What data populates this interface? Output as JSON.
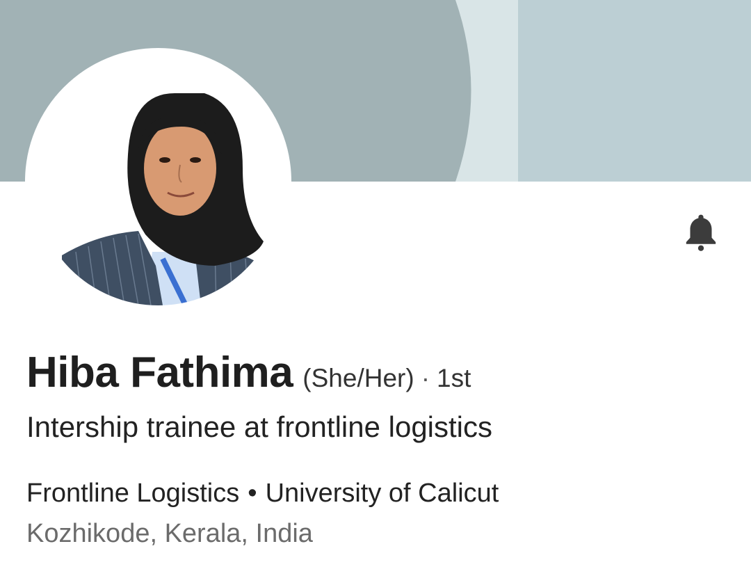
{
  "profile": {
    "name": "Hiba Fathima",
    "pronouns": "(She/Her)",
    "degree_separator": "·",
    "connection_degree": "1st",
    "headline": "Intership trainee at frontline logistics",
    "company": "Frontline Logistics",
    "affiliation_separator": "•",
    "school": "University of Calicut",
    "location": "Kozhikode, Kerala, India"
  },
  "actions": {
    "notification_icon": "bell-icon"
  },
  "colors": {
    "cover_dark": "#a1b2b5",
    "cover_light": "#bccfd4",
    "cover_highlight": "#d9e5e7",
    "text_primary": "#1f1f1f",
    "text_secondary": "#6b6b6b",
    "icon": "#3c3c3c"
  }
}
